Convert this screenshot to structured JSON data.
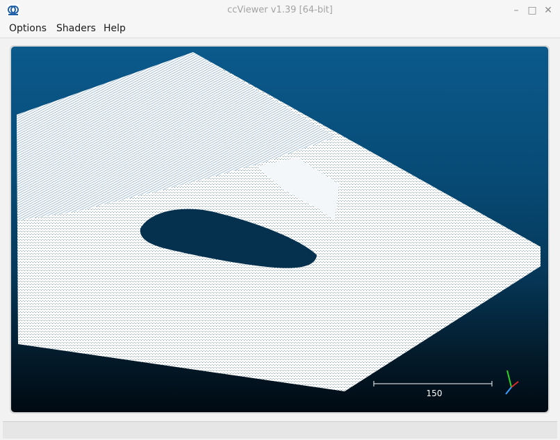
{
  "window": {
    "title": "ccViewer v1.39 [64-bit]",
    "app_icon_text": "CC"
  },
  "menubar": {
    "items": [
      "Options",
      "Shaders",
      "Help"
    ]
  },
  "viewport": {
    "scale_bar_label": "150"
  }
}
